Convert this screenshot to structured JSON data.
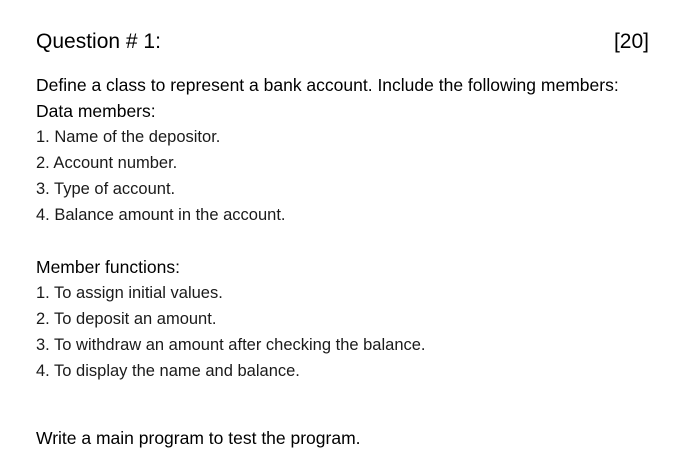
{
  "question": {
    "title": "Question # 1:",
    "marks": "[20]"
  },
  "intro": "Define a class to represent a bank account. Include the following members:",
  "data_members": {
    "heading": "Data members:",
    "items": [
      "1. Name of the depositor.",
      "2. Account number.",
      "3. Type of account.",
      "4. Balance amount in the account."
    ]
  },
  "member_functions": {
    "heading": "Member functions:",
    "items": [
      "1. To assign initial values.",
      "2. To deposit an amount.",
      "3. To withdraw an amount after checking the balance.",
      "4. To display the name and balance."
    ]
  },
  "closing": "Write a main program to test the program."
}
